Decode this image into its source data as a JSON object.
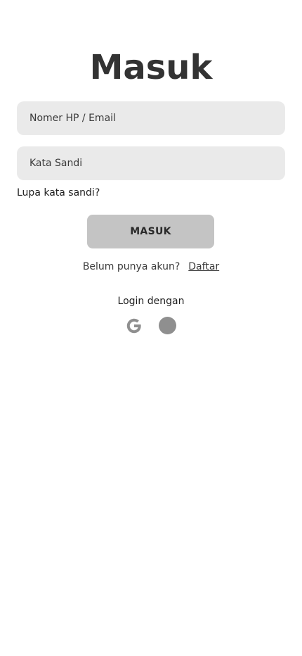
{
  "page": {
    "title": "Masuk"
  },
  "form": {
    "phone_email_placeholder": "Nomer HP / Email",
    "phone_email_value": "",
    "password_placeholder": "Kata Sandi",
    "password_value": "",
    "forgot_password": "Lupa kata sandi?",
    "submit_label": "MASUK"
  },
  "register": {
    "prompt": "Belum punya akun?",
    "link_label": "Daftar"
  },
  "social_login": {
    "label": "Login dengan",
    "providers": [
      {
        "icon": "google-icon"
      },
      {
        "icon": "circle-icon"
      }
    ]
  },
  "colors": {
    "input_background": "#eaeaea",
    "button_background": "#c4c4c4",
    "icon_color": "#8f8f8f",
    "text": "#2e2e2e"
  }
}
